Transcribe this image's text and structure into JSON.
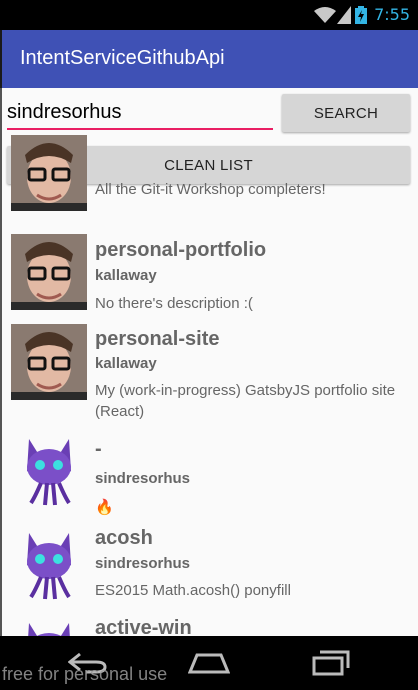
{
  "status_bar": {
    "time": "7:55",
    "icons": [
      "wifi-icon",
      "signal-icon",
      "battery-icon"
    ]
  },
  "app_bar": {
    "title": "IntentServiceGithubApi",
    "color": "#3f51b5"
  },
  "search": {
    "value": "sindresorhus",
    "button_label": "SEARCH"
  },
  "clean_button_label": "CLEAN LIST",
  "repos": [
    {
      "name": "",
      "owner": "",
      "description": "All the Git-it Workshop completers!",
      "avatar": "kallaway-avatar"
    },
    {
      "name": "personal-portfolio",
      "owner": "kallaway",
      "description": "No there's description :(",
      "avatar": "kallaway-avatar"
    },
    {
      "name": "personal-site",
      "owner": "kallaway",
      "description": "My (work-in-progress) GatsbyJS portfolio site (React)",
      "avatar": "kallaway-avatar"
    },
    {
      "name": "-",
      "owner": "sindresorhus",
      "description": "🔥",
      "avatar": "sindresorhus-avatar"
    },
    {
      "name": "acosh",
      "owner": "sindresorhus",
      "description": "ES2015 Math.acosh() ponyfill",
      "avatar": "sindresorhus-avatar"
    },
    {
      "name": "active-win",
      "owner": "",
      "description": "",
      "avatar": "sindresorhus-avatar"
    }
  ],
  "nav_bar": {
    "icons": [
      "back-icon",
      "home-icon",
      "recents-icon"
    ]
  },
  "watermark": "free for personal use",
  "accent_color": "#e91e63"
}
